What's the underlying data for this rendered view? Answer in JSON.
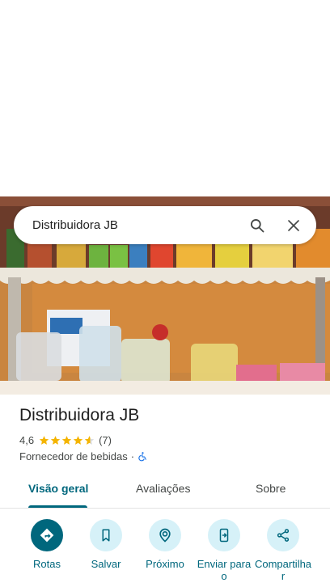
{
  "search": {
    "query": "Distribuidora JB"
  },
  "place": {
    "name": "Distribuidora JB",
    "rating": "4,6",
    "rating_stars": 4.6,
    "review_count": "(7)",
    "category": "Fornecedor de bebidas",
    "separator": "·"
  },
  "tabs": [
    {
      "label": "Visão geral"
    },
    {
      "label": "Avaliações"
    },
    {
      "label": "Sobre"
    }
  ],
  "actions": [
    {
      "label": "Rotas",
      "icon": "directions-icon"
    },
    {
      "label": "Salvar",
      "icon": "bookmark-icon"
    },
    {
      "label": "Próximo",
      "icon": "nearby-icon"
    },
    {
      "label": "Enviar para o",
      "icon": "send-to-phone-icon"
    },
    {
      "label": "Compartilhar",
      "icon": "share-icon"
    }
  ],
  "colors": {
    "accent": "#00677d",
    "accent_light": "#d6f1f8",
    "star": "#f4b400"
  }
}
